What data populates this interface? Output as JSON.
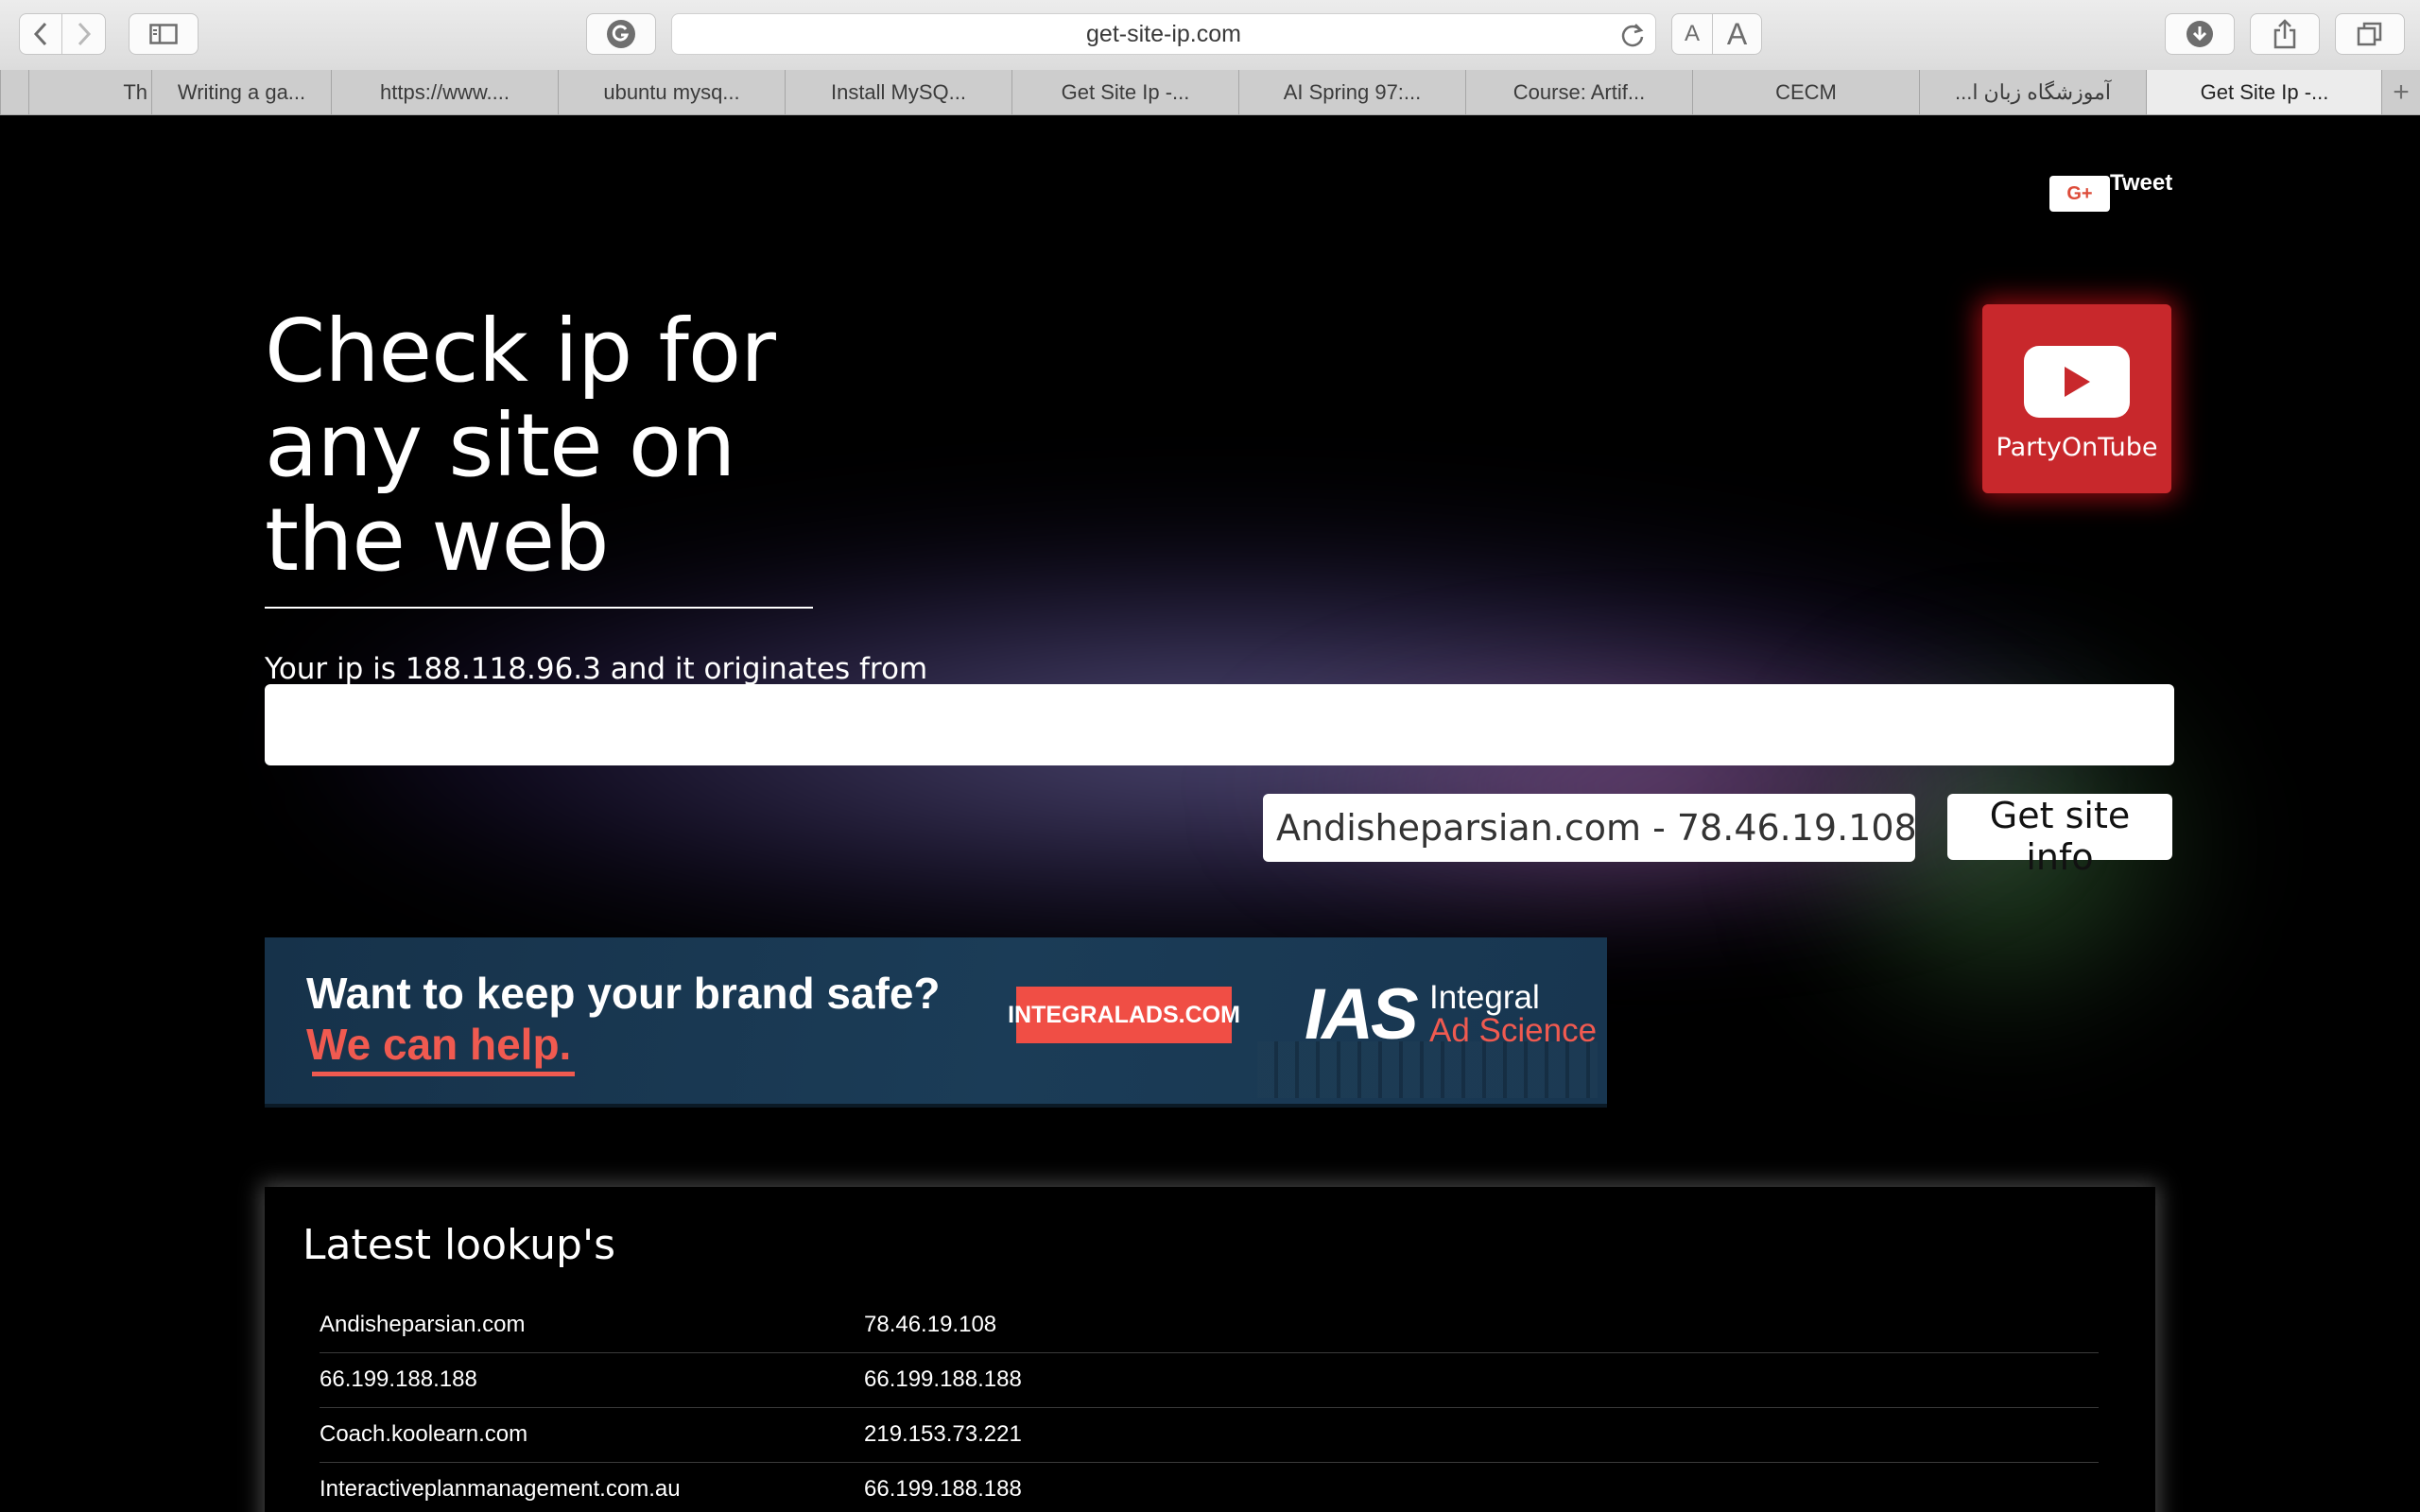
{
  "browser": {
    "url": "get-site-ip.com",
    "text_small": "A",
    "text_large": "A",
    "tabs": [
      {
        "label": "Th"
      },
      {
        "label": "Writing a ga..."
      },
      {
        "label": "https://www...."
      },
      {
        "label": "ubuntu mysq..."
      },
      {
        "label": "Install MySQ..."
      },
      {
        "label": "Get Site Ip -..."
      },
      {
        "label": "AI Spring 97:..."
      },
      {
        "label": "Course: Artif..."
      },
      {
        "label": "CECM"
      },
      {
        "label": "آموزشگاه زبان ا..."
      },
      {
        "label": "Get Site Ip -..."
      }
    ],
    "add_tab": "+"
  },
  "social": {
    "gplus": "G+",
    "tweet": "Tweet"
  },
  "partyontube": {
    "label": "PartyOnTube"
  },
  "headline": "Check ip for any site on the web",
  "ip_line": "Your ip is 188.118.96.3 and it originates from",
  "search": {
    "value": "",
    "placeholder": ""
  },
  "result": "Andisheparsian.com - 78.46.19.108 -",
  "get_info_button": "Get site info",
  "ad": {
    "line1": "Want to keep your brand safe?",
    "line2": "We can help.",
    "cta": "INTEGRALADS.COM",
    "logo": "IAS",
    "name_1": "Integral",
    "name_2": "Ad Science"
  },
  "lookups": {
    "title": "Latest lookup's",
    "rows": [
      {
        "site": "Andisheparsian.com",
        "ip": "78.46.19.108"
      },
      {
        "site": "66.199.188.188",
        "ip": "66.199.188.188"
      },
      {
        "site": "Coach.koolearn.com",
        "ip": "219.153.73.221"
      },
      {
        "site": "Interactiveplanmanagement.com.au",
        "ip": "66.199.188.188"
      }
    ]
  }
}
